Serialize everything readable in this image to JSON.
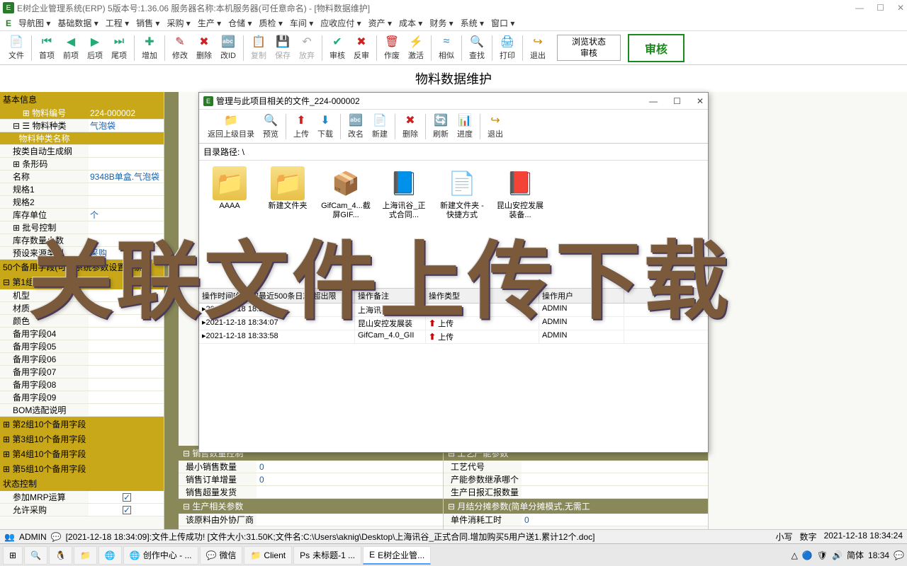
{
  "titlebar": {
    "text": "E树企业管理系统(ERP) 5版本号:1.36.06  服务器名称:本机服务器(可任意命名) - [物料数据维护]"
  },
  "menubar": [
    "导航图 ▾",
    "基础数据 ▾",
    "工程 ▾",
    "销售 ▾",
    "采购 ▾",
    "生产 ▾",
    "仓储 ▾",
    "质检 ▾",
    "车间 ▾",
    "应收应付 ▾",
    "资产 ▾",
    "成本 ▾",
    "财务 ▾",
    "系统 ▾",
    "窗口 ▾"
  ],
  "toolbar": [
    {
      "icon": "📄",
      "label": "文件",
      "c": "#c88"
    },
    {
      "sep": true
    },
    {
      "icon": "⏮",
      "label": "首项",
      "c": "#2a7"
    },
    {
      "icon": "◀",
      "label": "前项",
      "c": "#2a7"
    },
    {
      "icon": "▶",
      "label": "后项",
      "c": "#2a7"
    },
    {
      "icon": "⏭",
      "label": "尾项",
      "c": "#2a7"
    },
    {
      "sep": true
    },
    {
      "icon": "✚",
      "label": "增加",
      "c": "#2a7"
    },
    {
      "sep": true
    },
    {
      "icon": "✎",
      "label": "修改",
      "c": "#c22"
    },
    {
      "icon": "✖",
      "label": "删除",
      "c": "#c22"
    },
    {
      "icon": "🔤",
      "label": "改ID",
      "c": "#c22"
    },
    {
      "sep": true
    },
    {
      "icon": "📋",
      "label": "复制",
      "c": "#aaa",
      "dis": true
    },
    {
      "icon": "💾",
      "label": "保存",
      "c": "#aaa",
      "dis": true
    },
    {
      "icon": "↶",
      "label": "放弃",
      "c": "#aaa",
      "dis": true
    },
    {
      "sep": true
    },
    {
      "icon": "✔",
      "label": "审核",
      "c": "#2a7"
    },
    {
      "icon": "✖",
      "label": "反审",
      "c": "#c22"
    },
    {
      "sep": true
    },
    {
      "icon": "🗑",
      "label": "作废",
      "c": "#c22"
    },
    {
      "icon": "⚡",
      "label": "激活",
      "c": "#c80"
    },
    {
      "sep": true
    },
    {
      "icon": "≈",
      "label": "相似",
      "c": "#28c"
    },
    {
      "sep": true
    },
    {
      "icon": "🔍",
      "label": "查找",
      "c": "#c80"
    },
    {
      "sep": true
    },
    {
      "icon": "🖨",
      "label": "打印",
      "c": "#28c"
    },
    {
      "sep": true
    },
    {
      "icon": "↪",
      "label": "退出",
      "c": "#c80"
    }
  ],
  "status_box": {
    "line1": "浏览状态",
    "line2": "审核"
  },
  "audit_btn": "审核",
  "page_title": "物料数据维护",
  "sidebar": {
    "basic_header": "基本信息",
    "rows1": [
      {
        "k": "⊞ 物料编号",
        "v": "224-000002",
        "hl": true
      },
      {
        "k": "⊟ ☰ 物料种类",
        "v": "气泡袋"
      },
      {
        "k": "物料种类名称",
        "v": "",
        "hl": true
      },
      {
        "k": "按类自动生成纲",
        "v": ""
      },
      {
        "k": "⊞ 条形码",
        "v": ""
      },
      {
        "k": "名称",
        "v": "9348B单盒.气泡袋"
      },
      {
        "k": "规格1",
        "v": ""
      },
      {
        "k": "规格2",
        "v": ""
      },
      {
        "k": "库存单位",
        "v": "个"
      },
      {
        "k": "⊞ 批号控制",
        "v": ""
      },
      {
        "k": "库存数量小数",
        "v": ""
      },
      {
        "k": "预设来源类型",
        "v": "采购"
      }
    ],
    "group50": "50个备用字段(可在系统参数设置中统",
    "group1": "⊟ 第1组10个备用字段",
    "rows2": [
      {
        "k": "机型",
        "v": ""
      },
      {
        "k": "材质",
        "v": ""
      },
      {
        "k": "颜色",
        "v": ""
      },
      {
        "k": "备用字段04",
        "v": ""
      },
      {
        "k": "备用字段05",
        "v": ""
      },
      {
        "k": "备用字段06",
        "v": ""
      },
      {
        "k": "备用字段07",
        "v": ""
      },
      {
        "k": "备用字段08",
        "v": ""
      },
      {
        "k": "备用字段09",
        "v": ""
      },
      {
        "k": "BOM选配说明",
        "v": ""
      }
    ],
    "groups": [
      "⊞ 第2组10个备用字段",
      "⊞ 第3组10个备用字段",
      "⊞ 第4组10个备用字段",
      "⊞ 第5组10个备用字段"
    ],
    "state_header": "状态控制",
    "rows3": [
      {
        "k": "参加MRP运算",
        "v": "",
        "cb": true,
        "checked": true
      },
      {
        "k": "允许采购",
        "v": "",
        "cb": true,
        "checked": true
      }
    ]
  },
  "content_col1": {
    "g1": "销售数量控制",
    "rows": [
      {
        "k": "最小销售数量",
        "v": "0"
      },
      {
        "k": "销售订单增量",
        "v": "0"
      },
      {
        "k": "销售超量发货",
        "v": ""
      }
    ],
    "g2": "生产相关参数",
    "rows2": [
      {
        "k": "该原料由外协厂商",
        "v": "",
        "cb": true
      }
    ]
  },
  "content_col2": {
    "g1": "工艺产能参数",
    "rows": [
      {
        "k": "工艺代号",
        "v": ""
      },
      {
        "k": "产能参数继承哪个",
        "v": ""
      },
      {
        "k": "生产日报汇报数量",
        "v": ""
      }
    ],
    "g2": "月结分摊参数(简单分摊模式,无需工",
    "rows2": [
      {
        "k": "单件消耗工时",
        "v": "0"
      }
    ]
  },
  "modal": {
    "title": "管理与此项目相关的文件_224-000002",
    "toolbar": [
      {
        "icon": "📁",
        "label": "返回上级目录"
      },
      {
        "icon": "🔍",
        "label": "预览"
      },
      {
        "sep": true
      },
      {
        "icon": "⬆",
        "label": "上传",
        "c": "#c22"
      },
      {
        "icon": "⬇",
        "label": "下载",
        "c": "#28c"
      },
      {
        "sep": true
      },
      {
        "icon": "🔤",
        "label": "改名",
        "c": "#28c"
      },
      {
        "icon": "📄",
        "label": "新建",
        "c": "#28c"
      },
      {
        "sep": true
      },
      {
        "icon": "✖",
        "label": "删除",
        "c": "#c22"
      },
      {
        "sep": true
      },
      {
        "icon": "🔄",
        "label": "刷新",
        "c": "#28c"
      },
      {
        "icon": "📊",
        "label": "进度",
        "c": "#c80"
      },
      {
        "sep": true
      },
      {
        "icon": "↪",
        "label": "退出",
        "c": "#c80"
      }
    ],
    "path_label": "目录路径:  \\",
    "files": [
      {
        "type": "folder",
        "name": "AAAA"
      },
      {
        "type": "folder",
        "name": "新建文件夹"
      },
      {
        "type": "rar",
        "name": "GifCam_4...截屏GIF..."
      },
      {
        "type": "doc",
        "name": "上海讯谷_正式合同..."
      },
      {
        "type": "link",
        "name": "新建文件夹 - 快捷方式"
      },
      {
        "type": "pdf",
        "name": "昆山安控发展装备..."
      }
    ],
    "log_head": [
      "操作时间[仅读取最近500条日志,超出限",
      "操作备注",
      "操作类型",
      "操作用户"
    ],
    "log_rows": [
      {
        "t": "2021-12-18 18:34:09",
        "r": "上海讯谷_正式",
        "op": "上传",
        "u": "ADMIN"
      },
      {
        "t": "2021-12-18 18:34:07",
        "r": "昆山安控发展装",
        "op": "上传",
        "u": "ADMIN"
      },
      {
        "t": "2021-12-18 18:33:58",
        "r": "GifCam_4.0_GII",
        "op": "上传",
        "u": "ADMIN"
      }
    ]
  },
  "overlay": "关联文件上传下载",
  "statusbar": {
    "user": "ADMIN",
    "msg": "[2021-12-18 18:34:09]:文件上传成功! [文件大小:31.50K;文件名:C:\\Users\\aknig\\Desktop\\上海讯谷_正式合同.增加购买5用户送1.累计12个.doc]",
    "right": [
      "小写",
      "数字",
      "2021-12-18 18:34:24"
    ]
  },
  "taskbar": {
    "items": [
      {
        "icon": "⊞",
        "label": ""
      },
      {
        "icon": "🔍",
        "label": ""
      },
      {
        "icon": "🐧",
        "label": ""
      },
      {
        "icon": "📁",
        "label": ""
      },
      {
        "icon": "🌐",
        "label": ""
      },
      {
        "icon": "🌐",
        "label": "创作中心 - ..."
      },
      {
        "icon": "💬",
        "label": "微信"
      },
      {
        "icon": "📁",
        "label": "Client"
      },
      {
        "icon": "Ps",
        "label": "未标题-1 ..."
      },
      {
        "icon": "E",
        "label": "E树企业管...",
        "active": true
      }
    ],
    "tray_time": "18:34",
    "tray_lang": "简体"
  }
}
